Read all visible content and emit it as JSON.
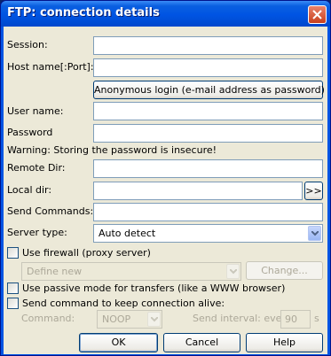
{
  "window": {
    "title": "FTP: connection details"
  },
  "fields": {
    "session": {
      "label": "Session:",
      "value": ""
    },
    "host": {
      "label": "Host name[:Port]:",
      "value": ""
    },
    "anonymous_button": "Anonymous login (e-mail address as password)",
    "user": {
      "label": "User name:",
      "value": ""
    },
    "password": {
      "label": "Password",
      "value": ""
    },
    "warning": "Warning: Storing the password is insecure!",
    "remote_dir": {
      "label": "Remote Dir:",
      "value": ""
    },
    "local_dir": {
      "label": "Local dir:",
      "value": "",
      "browse": ">>"
    },
    "send_commands": {
      "label": "Send Commands:",
      "value": ""
    },
    "server_type": {
      "label": "Server type:",
      "value": "Auto detect"
    }
  },
  "firewall": {
    "checkbox_label": "Use firewall (proxy server)",
    "checked": false,
    "combo_value": "Define new",
    "change_button": "Change..."
  },
  "passive": {
    "label": "Use passive mode for transfers (like a WWW browser)",
    "checked": false
  },
  "keepalive": {
    "label": "Send command to keep connection alive:",
    "checked": false,
    "command_label": "Command:",
    "command_value": "NOOP",
    "interval_label": "Send interval: every",
    "interval_value": "90",
    "interval_unit": "s"
  },
  "buttons": {
    "ok": "OK",
    "cancel": "Cancel",
    "help": "Help"
  },
  "colors": {
    "title_bar": "#0054e3",
    "client_bg": "#ece9d8",
    "close_button": "#c9401d"
  }
}
